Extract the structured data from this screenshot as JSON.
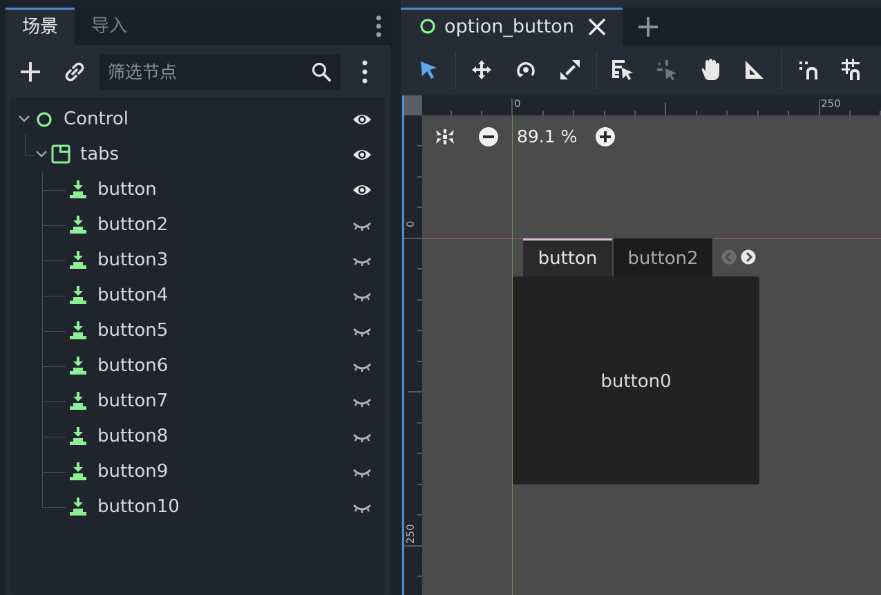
{
  "dock": {
    "tabs": [
      "场景",
      "导入"
    ],
    "filter_placeholder": "筛选节点"
  },
  "tree": {
    "nodes": [
      {
        "label": "Control",
        "icon": "control-node-icon",
        "visible": true
      },
      {
        "label": "tabs",
        "icon": "tab-container-icon",
        "visible": true
      },
      {
        "label": "button",
        "icon": "instanced-scene-icon",
        "visible": true
      },
      {
        "label": "button2",
        "icon": "instanced-scene-icon",
        "visible": false
      },
      {
        "label": "button3",
        "icon": "instanced-scene-icon",
        "visible": false
      },
      {
        "label": "button4",
        "icon": "instanced-scene-icon",
        "visible": false
      },
      {
        "label": "button5",
        "icon": "instanced-scene-icon",
        "visible": false
      },
      {
        "label": "button6",
        "icon": "instanced-scene-icon",
        "visible": false
      },
      {
        "label": "button7",
        "icon": "instanced-scene-icon",
        "visible": false
      },
      {
        "label": "button8",
        "icon": "instanced-scene-icon",
        "visible": false
      },
      {
        "label": "button9",
        "icon": "instanced-scene-icon",
        "visible": false
      },
      {
        "label": "button10",
        "icon": "instanced-scene-icon",
        "visible": false
      }
    ]
  },
  "editor": {
    "scene_tab": "option_button",
    "zoom": "89.1 %",
    "ruler_top_labels": [
      "0",
      "250"
    ],
    "ruler_left_labels": [
      "0",
      "250"
    ],
    "toolbar_icons": [
      "select-icon",
      "move-icon",
      "rotate-icon",
      "scale-icon",
      "list-select-icon",
      "pivot-icon",
      "pan-icon",
      "ruler-icon",
      "smart-snap-icon",
      "grid-snap-icon"
    ]
  },
  "canvas": {
    "tabs": [
      "button",
      "button2"
    ],
    "content": "button0"
  },
  "colors": {
    "accent": "#4c8ed6",
    "node_green": "#8eef97",
    "active_tab_top": "#e8b6d8"
  }
}
